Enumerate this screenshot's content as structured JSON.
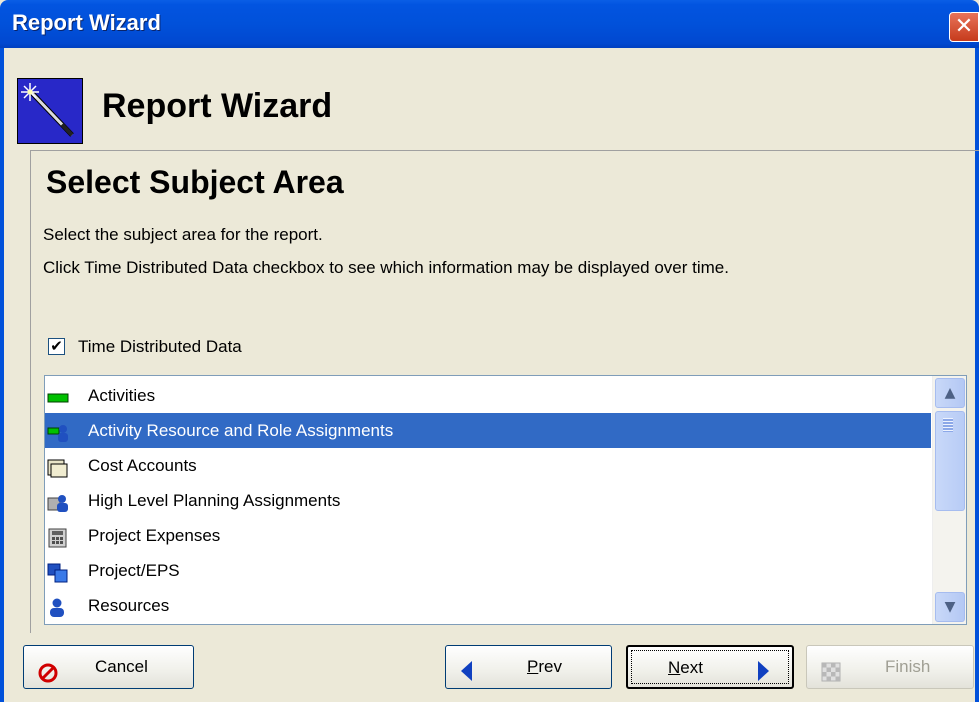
{
  "window": {
    "title": "Report Wizard",
    "close_glyph": "✕"
  },
  "header": {
    "title": "Report Wizard",
    "logo_icon": "magic-wand-icon"
  },
  "page": {
    "title": "Select Subject Area",
    "description_1": "Select the subject area for the report.",
    "description_2": "Click Time Distributed Data checkbox to see which information may be displayed over time."
  },
  "checkbox": {
    "label": "Time Distributed Data",
    "checked": true,
    "check_glyph": "✔"
  },
  "list": {
    "items": [
      {
        "label": "Activities",
        "icon": "activity-bar-icon",
        "selected": false
      },
      {
        "label": "Activity Resource and Role Assignments",
        "icon": "assignment-icon",
        "selected": true
      },
      {
        "label": "Cost Accounts",
        "icon": "folder-icon",
        "selected": false
      },
      {
        "label": "High Level Planning Assignments",
        "icon": "planning-icon",
        "selected": false
      },
      {
        "label": "Project Expenses",
        "icon": "calculator-icon",
        "selected": false
      },
      {
        "label": "Project/EPS",
        "icon": "project-eps-icon",
        "selected": false
      },
      {
        "label": "Resources",
        "icon": "person-icon",
        "selected": false
      }
    ]
  },
  "scrollbar": {
    "up_glyph": "▲",
    "down_glyph": "▼"
  },
  "buttons": {
    "cancel": "Cancel",
    "prev_first": "P",
    "prev_rest": "rev",
    "next_first": "N",
    "next_rest": "ext",
    "finish": "Finish"
  },
  "colors": {
    "titlebar": "#0151da",
    "selection": "#316ac5",
    "background": "#ece9d8"
  }
}
